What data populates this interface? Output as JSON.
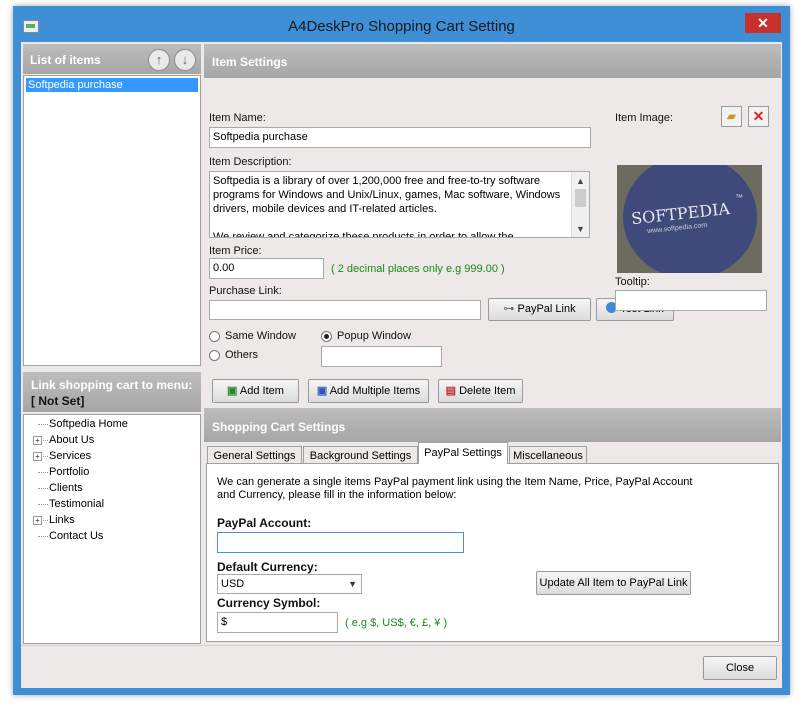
{
  "window": {
    "title": "A4DeskPro Shopping Cart Setting",
    "close_glyph": "✕"
  },
  "left_panel": {
    "list_header": "List of items",
    "items": [
      "Softpedia purchase"
    ],
    "link_header": "Link shopping cart to menu:",
    "link_value": "[ Not Set]",
    "menu_tree": [
      {
        "label": "Softpedia Home",
        "expandable": false
      },
      {
        "label": "About Us",
        "expandable": true
      },
      {
        "label": "Services",
        "expandable": true
      },
      {
        "label": "Portfolio",
        "expandable": false
      },
      {
        "label": "Clients",
        "expandable": false
      },
      {
        "label": "Testimonial",
        "expandable": false
      },
      {
        "label": "Links",
        "expandable": true
      },
      {
        "label": "Contact Us",
        "expandable": false
      }
    ]
  },
  "item_settings": {
    "header": "Item Settings",
    "name_label": "Item Name:",
    "name_value": "Softpedia purchase",
    "desc_label": "Item Description:",
    "desc_value": "Softpedia is a library of over 1,200,000 free and free-to-try software programs for Windows and Unix/Linux, games, Mac software, Windows drivers, mobile devices and IT-related articles.\n\nWe review and categorize these products in order to allow the",
    "price_label": "Item Price:",
    "price_value": "0.00",
    "price_hint": "( 2 decimal places only e.g 999.00 )",
    "link_label": "Purchase Link:",
    "link_value": "",
    "paypal_link_btn": "PayPal Link",
    "test_link_btn": "Test Link",
    "image_label": "Item Image:",
    "image_text": "SOFTPEDIA",
    "image_tm": "™",
    "image_url": "www.softpedia.com",
    "tooltip_label": "Tooltip:",
    "tooltip_value": "",
    "radio_same": "Same Window",
    "radio_popup": "Popup Window",
    "radio_others": "Others",
    "others_value": "",
    "add_item_btn": "Add Item",
    "add_multiple_btn": "Add Multiple Items",
    "delete_item_btn": "Delete Item"
  },
  "cart_settings": {
    "header": "Shopping Cart Settings",
    "tabs": [
      "General Settings",
      "Background Settings",
      "PayPal Settings",
      "Miscellaneous"
    ],
    "active_tab": "PayPal Settings",
    "intro": "We can generate a single items PayPal payment link using the Item Name, Price, PayPal Account and Currency, please fill in the information below:",
    "account_label": "PayPal Account:",
    "account_value": "",
    "currency_label": "Default Currency:",
    "currency_value": "USD",
    "update_btn": "Update All Item to PayPal Link",
    "symbol_label": "Currency Symbol:",
    "symbol_value": "$",
    "symbol_hint": "( e.g $, US$, €, £, ¥ )"
  },
  "footer": {
    "close_btn": "Close"
  },
  "colors": {
    "title_bar": "#3f8fd6",
    "header_gray": "#a6a6a6",
    "selection": "#3399ff",
    "hint_green": "#1a8a1a",
    "close_red": "#c7312b"
  }
}
